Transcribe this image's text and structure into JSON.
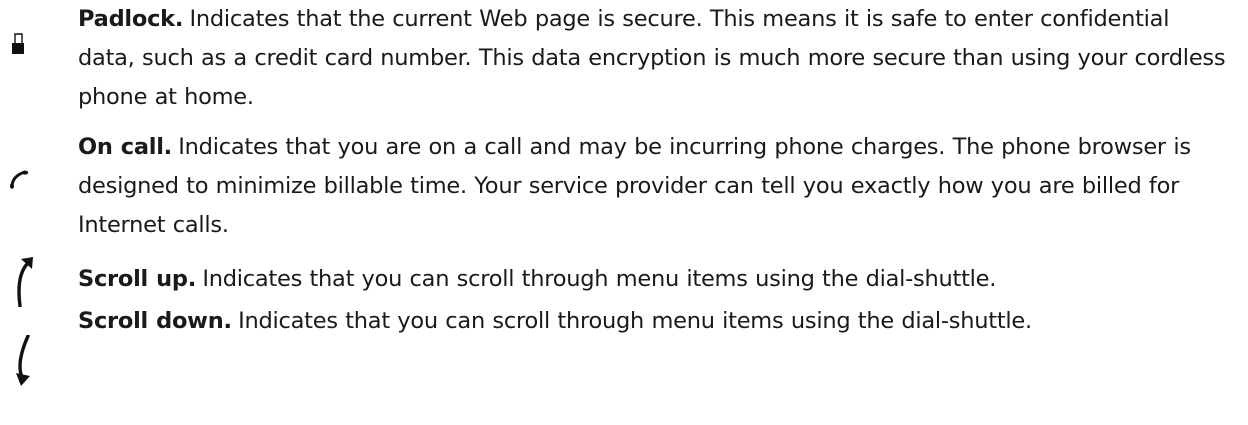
{
  "entries": [
    {
      "icon": "padlock-icon",
      "term": "Padlock.",
      "text": "Indicates that the current Web page is secure. This means it is safe to enter confidential data, such as a credit card number. This data encryption is much more secure than using your cordless phone at home."
    },
    {
      "icon": "phone-handset-icon",
      "term": "On call.",
      "text": "Indicates that you are on a call and may be incurring phone charges. The phone browser is designed to minimize billable time. Your service provider can tell you exactly how you are billed for Internet calls."
    },
    {
      "icon": "scroll-up-arrow-icon",
      "term": "Scroll up.",
      "text": "Indicates that you can scroll through menu items using the dial-shuttle."
    },
    {
      "icon": "scroll-down-arrow-icon",
      "term": "Scroll down.",
      "text": "Indicates that you can scroll through menu items using the dial-shuttle."
    }
  ]
}
